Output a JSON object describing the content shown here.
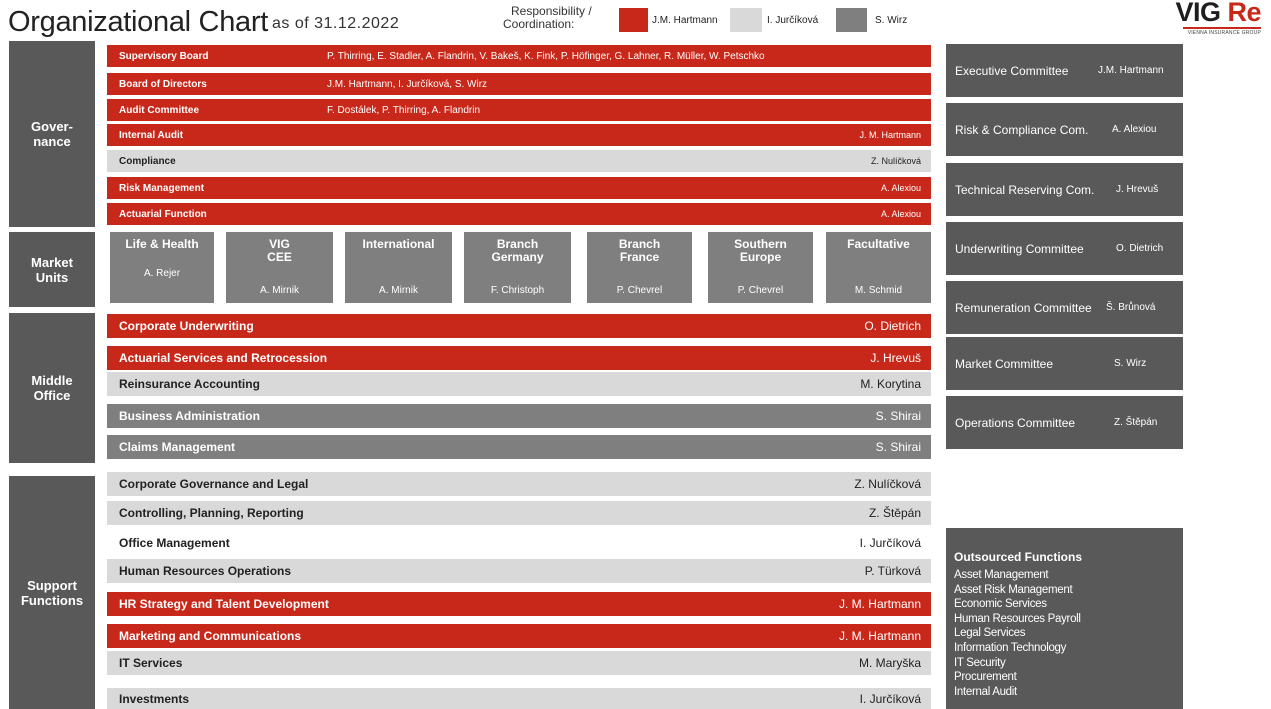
{
  "header": {
    "title": "Organizational Chart",
    "as_of": "as of 31.12.2022",
    "responsibility_line1": "Responsibility /",
    "responsibility_line2": "Coordination:",
    "legend": [
      {
        "name": "J.M. Hartmann",
        "color": "#c8281a"
      },
      {
        "name": "I. Jurčíková",
        "color": "#d9d9d9"
      },
      {
        "name": "S. Wirz",
        "color": "#7f7f7f"
      }
    ],
    "logo": {
      "vig": "VIG",
      "re": "Re",
      "tagline": "VIENNA INSURANCE GROUP"
    }
  },
  "colors": {
    "red": "#c8281a",
    "light_grey": "#d9d9d9",
    "mid_grey": "#7f7f7f",
    "dark_grey": "#595959"
  },
  "sections": {
    "governance": "Gover-\nnance",
    "market_units": "Market\nUnits",
    "middle_office": "Middle\nOffice",
    "support_functions": "Support\nFunctions"
  },
  "governance": [
    {
      "name": "Supervisory Board",
      "members": "P. Thirring, E. Stadler, A. Flandrin, V. Bakeš, K. Fink, P. Höfinger, G. Lahner, R. Müller, W. Petschko",
      "head": ""
    },
    {
      "name": "Board of Directors",
      "members": "J.M. Hartmann, I. Jurčíková, S. Wirz",
      "head": ""
    },
    {
      "name": "Audit Committee",
      "members": "F. Dostálek, P. Thirring, A. Flandrin",
      "head": ""
    },
    {
      "name": "Internal Audit",
      "members": "",
      "head": "J. M. Hartmann"
    },
    {
      "name": "Compliance",
      "members": "",
      "head": "Z. Nulíčková"
    },
    {
      "name": "Risk Management",
      "members": "",
      "head": "A. Alexiou"
    },
    {
      "name": "Actuarial Function",
      "members": "",
      "head": "A. Alexiou"
    }
  ],
  "market_units": [
    {
      "name": "Life & Health",
      "head": "A. Rejer"
    },
    {
      "name": "VIG\nCEE",
      "head": "A. Mirnik"
    },
    {
      "name": "International",
      "head": "A. Mirnik"
    },
    {
      "name": "Branch\nGermany",
      "head": "F. Christoph"
    },
    {
      "name": "Branch\nFrance",
      "head": "P. Chevrel"
    },
    {
      "name": "Southern\nEurope",
      "head": "P. Chevrel"
    },
    {
      "name": "Facultative",
      "head": "M. Schmid"
    }
  ],
  "middle_office": [
    {
      "name": "Corporate Underwriting",
      "head": "O. Dietrich"
    },
    {
      "name": "Actuarial Services and Retrocession",
      "head": "J. Hrevuš"
    },
    {
      "name": "Reinsurance Accounting",
      "head": "M. Korytina"
    },
    {
      "name": "Business Administration",
      "head": "S. Shirai"
    },
    {
      "name": "Claims Management",
      "head": "S. Shirai"
    }
  ],
  "support_functions": [
    {
      "name": "Corporate Governance and Legal",
      "head": "Z. Nulíčková"
    },
    {
      "name": "Controlling,  Planning, Reporting",
      "head": "Z. Štěpán"
    },
    {
      "name": "Office Management",
      "head": "I. Jurčíková"
    },
    {
      "name": "Human Resources Operations",
      "head": "P. Türková"
    },
    {
      "name": "HR Strategy and Talent Development",
      "head": "J. M. Hartmann"
    },
    {
      "name": "Marketing and Communications",
      "head": "J. M. Hartmann"
    },
    {
      "name": "IT Services",
      "head": "M. Maryška"
    },
    {
      "name": "Investments",
      "head": "I. Jurčíková"
    }
  ],
  "committees": [
    {
      "name": "Executive Committee",
      "head": "J.M. Hartmann"
    },
    {
      "name": "Risk & Compliance Com.",
      "head": "A. Alexiou"
    },
    {
      "name": "Technical Reserving Com.",
      "head": "J. Hrevuš"
    },
    {
      "name": "Underwriting Committee",
      "head": "O. Dietrich"
    },
    {
      "name": "Remuneration Committee",
      "head": "Š. Brůnová"
    },
    {
      "name": "Market Committee",
      "head": "S. Wirz"
    },
    {
      "name": "Operations Committee",
      "head": "Z. Štěpán"
    }
  ],
  "outsourced": {
    "title": "Outsourced Functions",
    "items": [
      "Asset Management",
      "Asset Risk Management",
      "Economic Services",
      "Human Resources Payroll",
      "Legal Services",
      "Information Technology",
      "IT Security",
      "Procurement",
      "Internal Audit"
    ]
  }
}
